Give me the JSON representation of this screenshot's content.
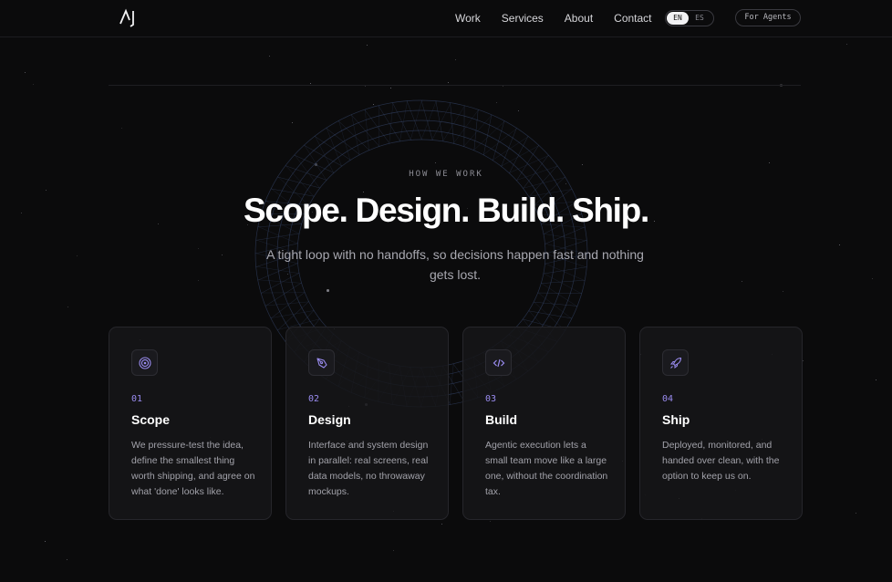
{
  "nav": {
    "items": [
      "Work",
      "Services",
      "About",
      "Contact"
    ],
    "lang_en": "EN",
    "lang_es": "ES",
    "agents_label": "For Agents"
  },
  "hero": {
    "eyebrow": "HOW WE WORK",
    "headline": "Scope. Design. Build. Ship.",
    "subtitle": "A tight loop with no handoffs, so decisions happen fast and nothing gets lost."
  },
  "cards": [
    {
      "icon": "target-icon",
      "num": "01",
      "title": "Scope",
      "desc": "We pressure-test the idea, define the smallest thing worth shipping, and agree on what 'done' looks like."
    },
    {
      "icon": "pen-tool-icon",
      "num": "02",
      "title": "Design",
      "desc": "Interface and system design in parallel: real screens, real data models, no throwaway mockups."
    },
    {
      "icon": "code-icon",
      "num": "03",
      "title": "Build",
      "desc": "Agentic execution lets a small team move like a large one, without the coordination tax."
    },
    {
      "icon": "rocket-icon",
      "num": "04",
      "title": "Ship",
      "desc": "Deployed, monitored, and handed over clean, with the option to keep us on."
    }
  ],
  "colors": {
    "accent": "#9a8cf0",
    "background": "#0b0b0c"
  }
}
